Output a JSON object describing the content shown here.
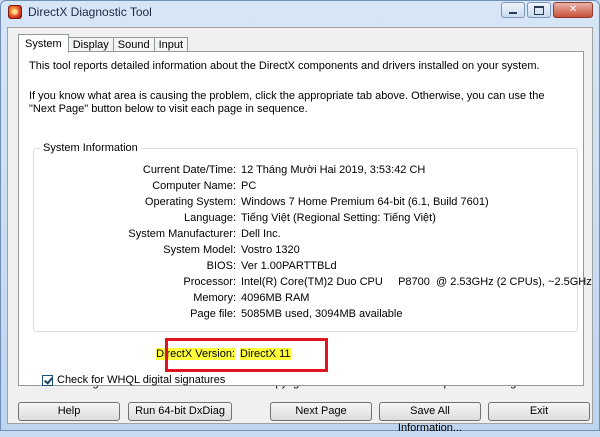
{
  "window": {
    "title": "DirectX Diagnostic Tool"
  },
  "tabs": [
    {
      "label": "System"
    },
    {
      "label": "Display"
    },
    {
      "label": "Sound"
    },
    {
      "label": "Input"
    }
  ],
  "intro": {
    "line1": "This tool reports detailed information about the DirectX components and drivers installed on your system.",
    "line2": "If you know what area is causing the problem, click the appropriate tab above.  Otherwise, you can use the \"Next Page\" button below to visit each page in sequence."
  },
  "system_info": {
    "title": "System Information",
    "rows": [
      {
        "label": "Current Date/Time:",
        "value": "12 Tháng Mười Hai 2019, 3:53:42 CH"
      },
      {
        "label": "Computer Name:",
        "value": "PC"
      },
      {
        "label": "Operating System:",
        "value": "Windows 7 Home Premium 64-bit (6.1, Build 7601)"
      },
      {
        "label": "Language:",
        "value": "Tiếng Việt (Regional Setting: Tiếng Việt)"
      },
      {
        "label": "System Manufacturer:",
        "value": "Dell Inc."
      },
      {
        "label": "System Model:",
        "value": "Vostro 1320"
      },
      {
        "label": "BIOS:",
        "value": "Ver 1.00PARTTBLd"
      },
      {
        "label": "Processor:",
        "value": "Intel(R) Core(TM)2 Duo CPU     P8700  @ 2.53GHz (2 CPUs), ~2.5GHz"
      },
      {
        "label": "Memory:",
        "value": "4096MB RAM"
      },
      {
        "label": "Page file:",
        "value": "5085MB used, 3094MB available"
      },
      {
        "label": "DirectX Version:",
        "value": "DirectX 11"
      }
    ]
  },
  "whql": {
    "label": "Check for WHQL digital signatures",
    "checked": true
  },
  "footer": {
    "version": "DxDiag 6.01.7601.17514 32-bit Unicode  Copyright © 1998-2006 Microsoft Corporation.  All rights reserved."
  },
  "buttons": {
    "help": "Help",
    "run64": "Run 64-bit DxDiag",
    "next": "Next Page",
    "save": "Save All Information...",
    "exit": "Exit"
  },
  "colors": {
    "highlight": "#ffff3c",
    "annotation_box": "#e0141e"
  }
}
